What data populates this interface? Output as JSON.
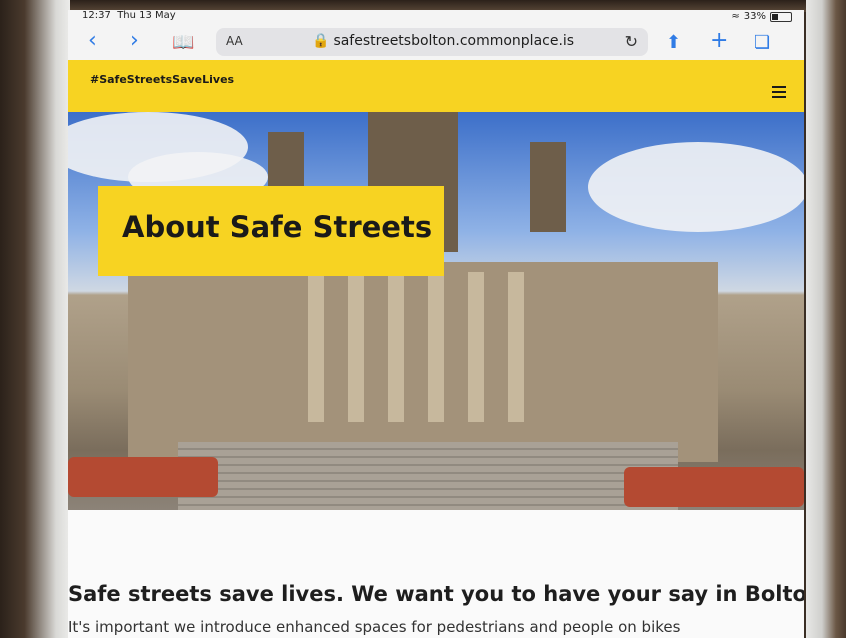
{
  "status_bar": {
    "time": "12:37",
    "date": "Thu 13 May",
    "battery": "33%"
  },
  "browser": {
    "text_size_label": "AA",
    "url": "safestreetsbolton.commonplace.is",
    "icons": {
      "back": "chevron-left-icon",
      "forward": "chevron-right-icon",
      "bookmarks": "book-icon",
      "reload": "reload-icon",
      "share": "share-icon",
      "new_tab": "plus-icon",
      "tabs": "tabs-icon"
    }
  },
  "site": {
    "hashtag": "#SafeStreetsSaveLives",
    "accent_color": "#f7d322",
    "hero_title": "About Safe Streets",
    "headline": "Safe streets save lives. We want you to have your say in Bolton",
    "body_text": "It's important we introduce enhanced spaces for pedestrians and people on bikes"
  }
}
